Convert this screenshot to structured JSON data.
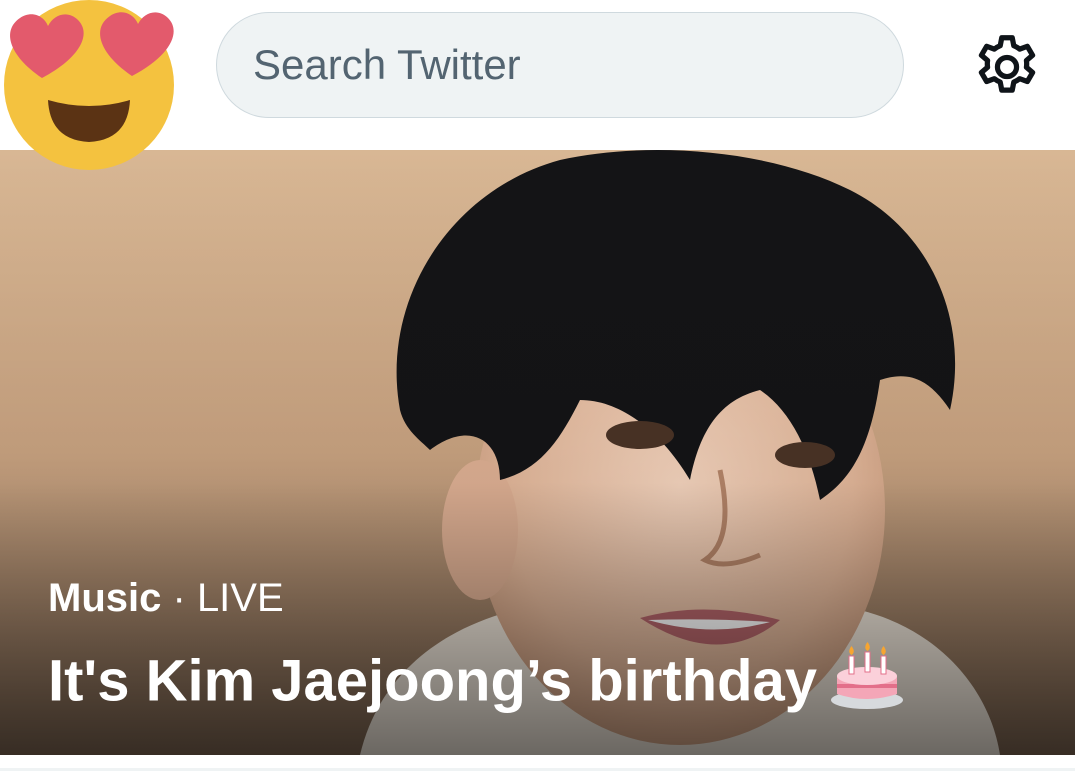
{
  "header": {
    "avatar_icon": "heart-eyes-face-emoji",
    "search": {
      "placeholder": "Search Twitter",
      "value": ""
    },
    "settings_icon": "gear-icon"
  },
  "hero": {
    "category": "Music",
    "separator": "·",
    "status": "LIVE",
    "title": "It's Kim Jaejoong’s birthday",
    "title_icon": "birthday-cake-emoji"
  },
  "colors": {
    "search_bg": "#eff3f4",
    "search_border": "#cfd9de",
    "placeholder": "#536471",
    "text_on_image": "#ffffff",
    "photo_bg": "#c9a582"
  }
}
